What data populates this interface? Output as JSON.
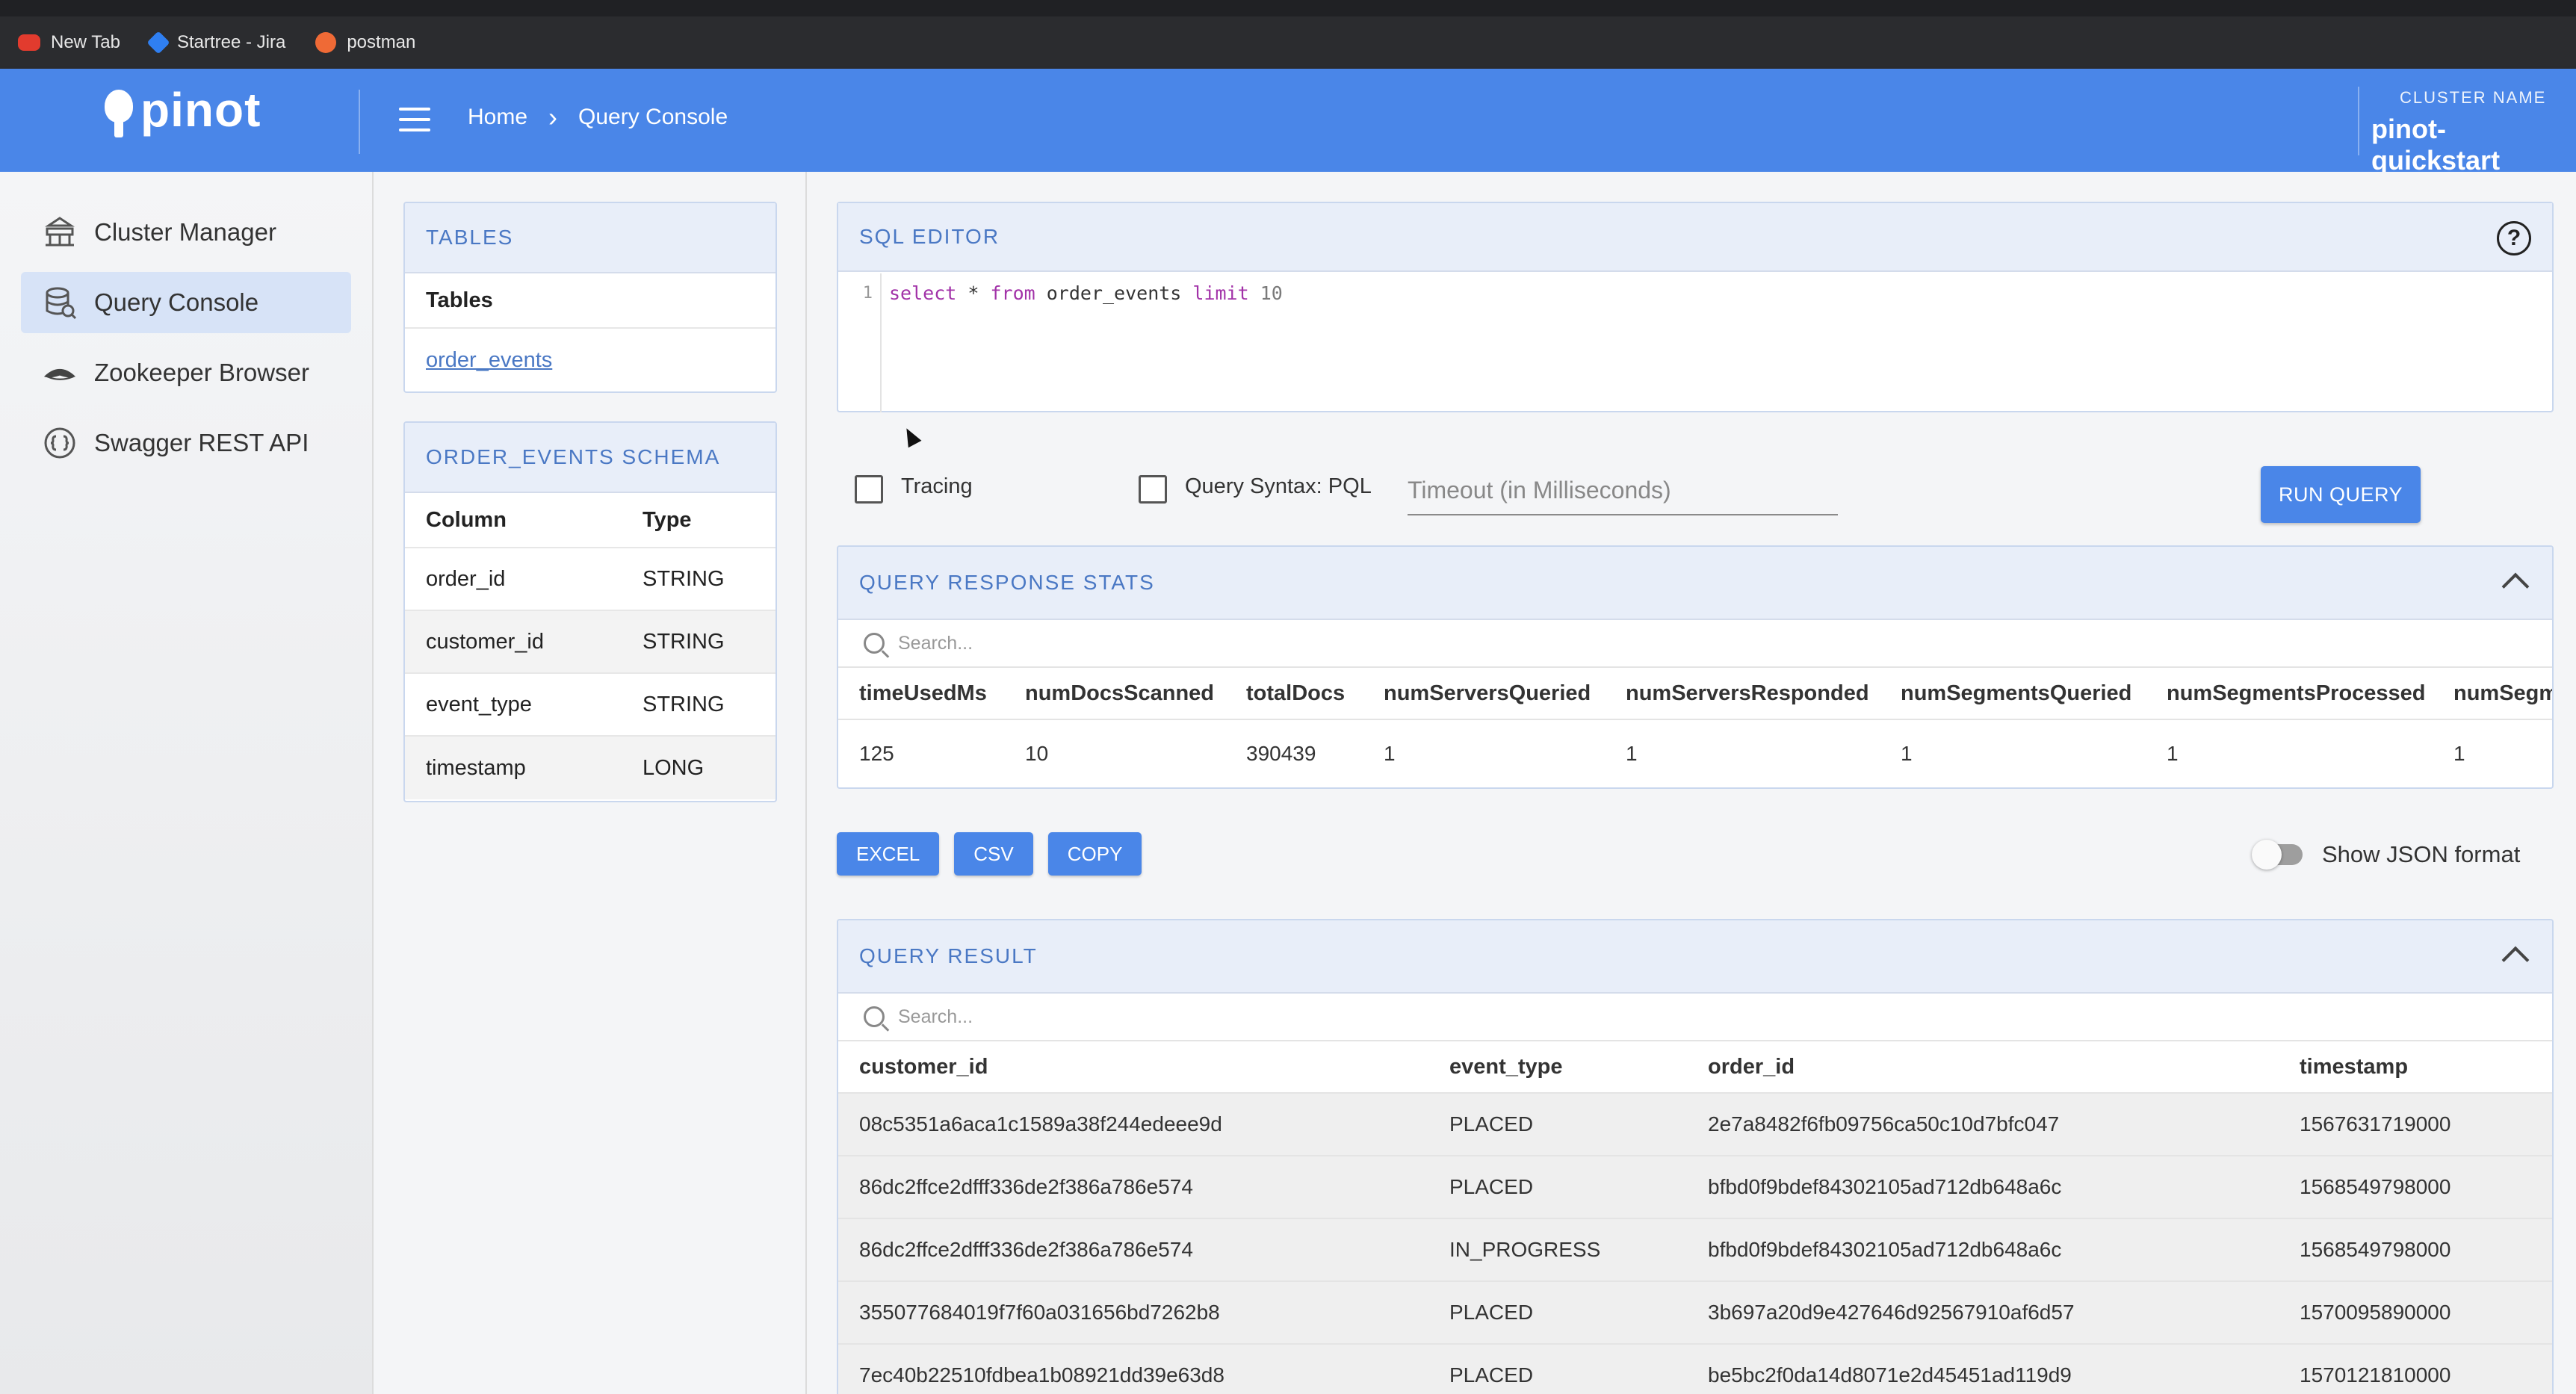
{
  "browser": {
    "bookmarks": [
      {
        "label": "New Tab",
        "icon": "youtube-icon"
      },
      {
        "label": "Startree - Jira",
        "icon": "jira-icon"
      },
      {
        "label": "postman",
        "icon": "postman-icon"
      }
    ]
  },
  "header": {
    "logo_text": "pinot",
    "breadcrumb": [
      "Home",
      "Query Console"
    ],
    "cluster_label": "CLUSTER NAME",
    "cluster_name": "pinot-quickstart",
    "accent_color": "#4a86e8"
  },
  "sidebar": {
    "items": [
      {
        "label": "Cluster Manager",
        "icon": "cluster-icon"
      },
      {
        "label": "Query Console",
        "icon": "database-icon",
        "active": true
      },
      {
        "label": "Zookeeper Browser",
        "icon": "zookeeper-icon"
      },
      {
        "label": "Swagger REST API",
        "icon": "api-icon"
      }
    ]
  },
  "tables_panel": {
    "title": "TABLES",
    "column_header": "Tables",
    "tables": [
      "order_events"
    ]
  },
  "schema_panel": {
    "title": "ORDER_EVENTS SCHEMA",
    "headers": [
      "Column",
      "Type"
    ],
    "rows": [
      [
        "order_id",
        "STRING"
      ],
      [
        "customer_id",
        "STRING"
      ],
      [
        "event_type",
        "STRING"
      ],
      [
        "timestamp",
        "LONG"
      ]
    ]
  },
  "editor": {
    "title": "SQL EDITOR",
    "line_number": "1",
    "query_tokens": {
      "select": "select",
      "star": " * ",
      "from": "from",
      "table": " order_events ",
      "limit": "limit",
      "limit_value": " 10"
    }
  },
  "options": {
    "tracing_label": "Tracing",
    "pql_label": "Query Syntax: PQL",
    "timeout_placeholder": "Timeout (in Milliseconds)",
    "run_label": "RUN QUERY"
  },
  "stats": {
    "title": "QUERY RESPONSE STATS",
    "search_placeholder": "Search...",
    "headers": [
      "timeUsedMs",
      "numDocsScanned",
      "totalDocs",
      "numServersQueried",
      "numServersResponded",
      "numSegmentsQueried",
      "numSegmentsProcessed",
      "numSegm"
    ],
    "values": [
      "125",
      "10",
      "390439",
      "1",
      "1",
      "1",
      "1",
      "1"
    ]
  },
  "export": {
    "excel": "EXCEL",
    "csv": "CSV",
    "copy": "COPY",
    "json_toggle_label": "Show JSON format"
  },
  "result": {
    "title": "QUERY RESULT",
    "search_placeholder": "Search...",
    "headers": [
      "customer_id",
      "event_type",
      "order_id",
      "timestamp"
    ],
    "rows": [
      [
        "08c5351a6aca1c1589a38f244edeee9d",
        "PLACED",
        "2e7a8482f6fb09756ca50c10d7bfc047",
        "1567631719000"
      ],
      [
        "86dc2ffce2dfff336de2f386a786e574",
        "PLACED",
        "bfbd0f9bdef84302105ad712db648a6c",
        "1568549798000"
      ],
      [
        "86dc2ffce2dfff336de2f386a786e574",
        "IN_PROGRESS",
        "bfbd0f9bdef84302105ad712db648a6c",
        "1568549798000"
      ],
      [
        "355077684019f7f60a031656bd7262b8",
        "PLACED",
        "3b697a20d9e427646d92567910af6d57",
        "1570095890000"
      ],
      [
        "7ec40b22510fdbea1b08921dd39e63d8",
        "PLACED",
        "be5bc2f0da14d8071e2d45451ad119d9",
        "1570121810000"
      ]
    ]
  }
}
